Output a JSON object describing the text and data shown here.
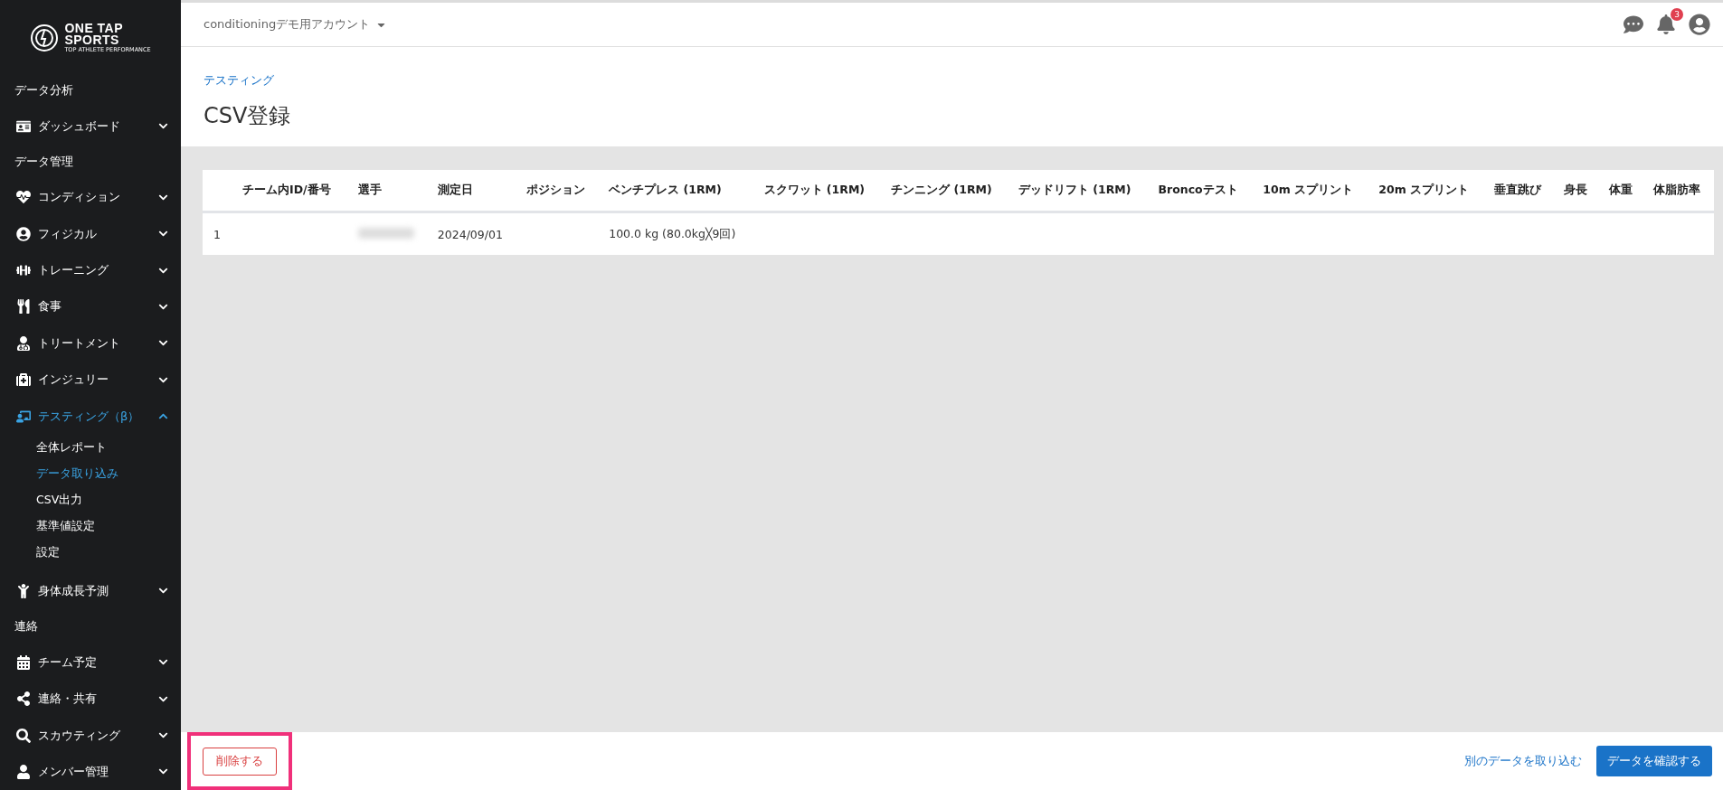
{
  "logo": {
    "line_1": "ONE TAP",
    "line_2": "SPORTS",
    "tagline": "TOP ATHLETE PERFORMANCE"
  },
  "sidebar": {
    "items": [
      {
        "kind": "section",
        "label": "データ分析"
      },
      {
        "kind": "menu",
        "label": "ダッシュボード",
        "expanded": false,
        "selected": false
      },
      {
        "kind": "section",
        "label": "データ管理"
      },
      {
        "kind": "menu",
        "label": "コンディション",
        "expanded": false,
        "selected": false
      },
      {
        "kind": "menu",
        "label": "フィジカル",
        "expanded": false,
        "selected": false
      },
      {
        "kind": "menu",
        "label": "トレーニング",
        "expanded": false,
        "selected": false
      },
      {
        "kind": "menu",
        "label": "食事",
        "expanded": false,
        "selected": false
      },
      {
        "kind": "menu",
        "label": "トリートメント",
        "expanded": false,
        "selected": false
      },
      {
        "kind": "menu",
        "label": "インジュリー",
        "expanded": false,
        "selected": false
      },
      {
        "kind": "menu",
        "label": "テスティング（β）",
        "expanded": true,
        "selected": true,
        "children": [
          {
            "label": "全体レポート",
            "selected": false
          },
          {
            "label": "データ取り込み",
            "selected": true
          },
          {
            "label": "CSV出力",
            "selected": false
          },
          {
            "label": "基準値設定",
            "selected": false
          },
          {
            "label": "設定",
            "selected": false
          }
        ]
      },
      {
        "kind": "menu",
        "label": "身体成長予測",
        "expanded": false,
        "selected": false
      },
      {
        "kind": "section",
        "label": "連絡"
      },
      {
        "kind": "menu",
        "label": "チーム予定",
        "expanded": false,
        "selected": false
      },
      {
        "kind": "menu",
        "label": "連絡・共有",
        "expanded": false,
        "selected": false
      },
      {
        "kind": "menu",
        "label": "スカウティング",
        "expanded": false,
        "selected": false
      },
      {
        "kind": "menu",
        "label": "メンバー管理",
        "expanded": false,
        "selected": false
      }
    ]
  },
  "header": {
    "account": "conditioningデモ用アカウント",
    "notification_count": "3"
  },
  "breadcrumb": "テスティング",
  "title": "CSV登録",
  "table": {
    "columns": [
      "チーム内ID/番号",
      "選手",
      "測定日",
      "ポジション",
      "ベンチプレス (1RM)",
      "スクワット (1RM)",
      "チンニング (1RM)",
      "デッドリフト (1RM)",
      "Broncoテスト",
      "10m スプリント",
      "20m スプリント",
      "垂直跳び",
      "身長",
      "体重",
      "体脂肪率"
    ],
    "rows": [
      {
        "id_number": "1",
        "player_redacted": true,
        "date": "2024/09/01",
        "bench_press": "100.0 kg (80.0kg╳9回)"
      }
    ]
  },
  "footer": {
    "delete_button": "削除する",
    "delete_highlighted": true,
    "import_link": "別のデータを取り込む",
    "confirm_button": "データを確認する"
  }
}
